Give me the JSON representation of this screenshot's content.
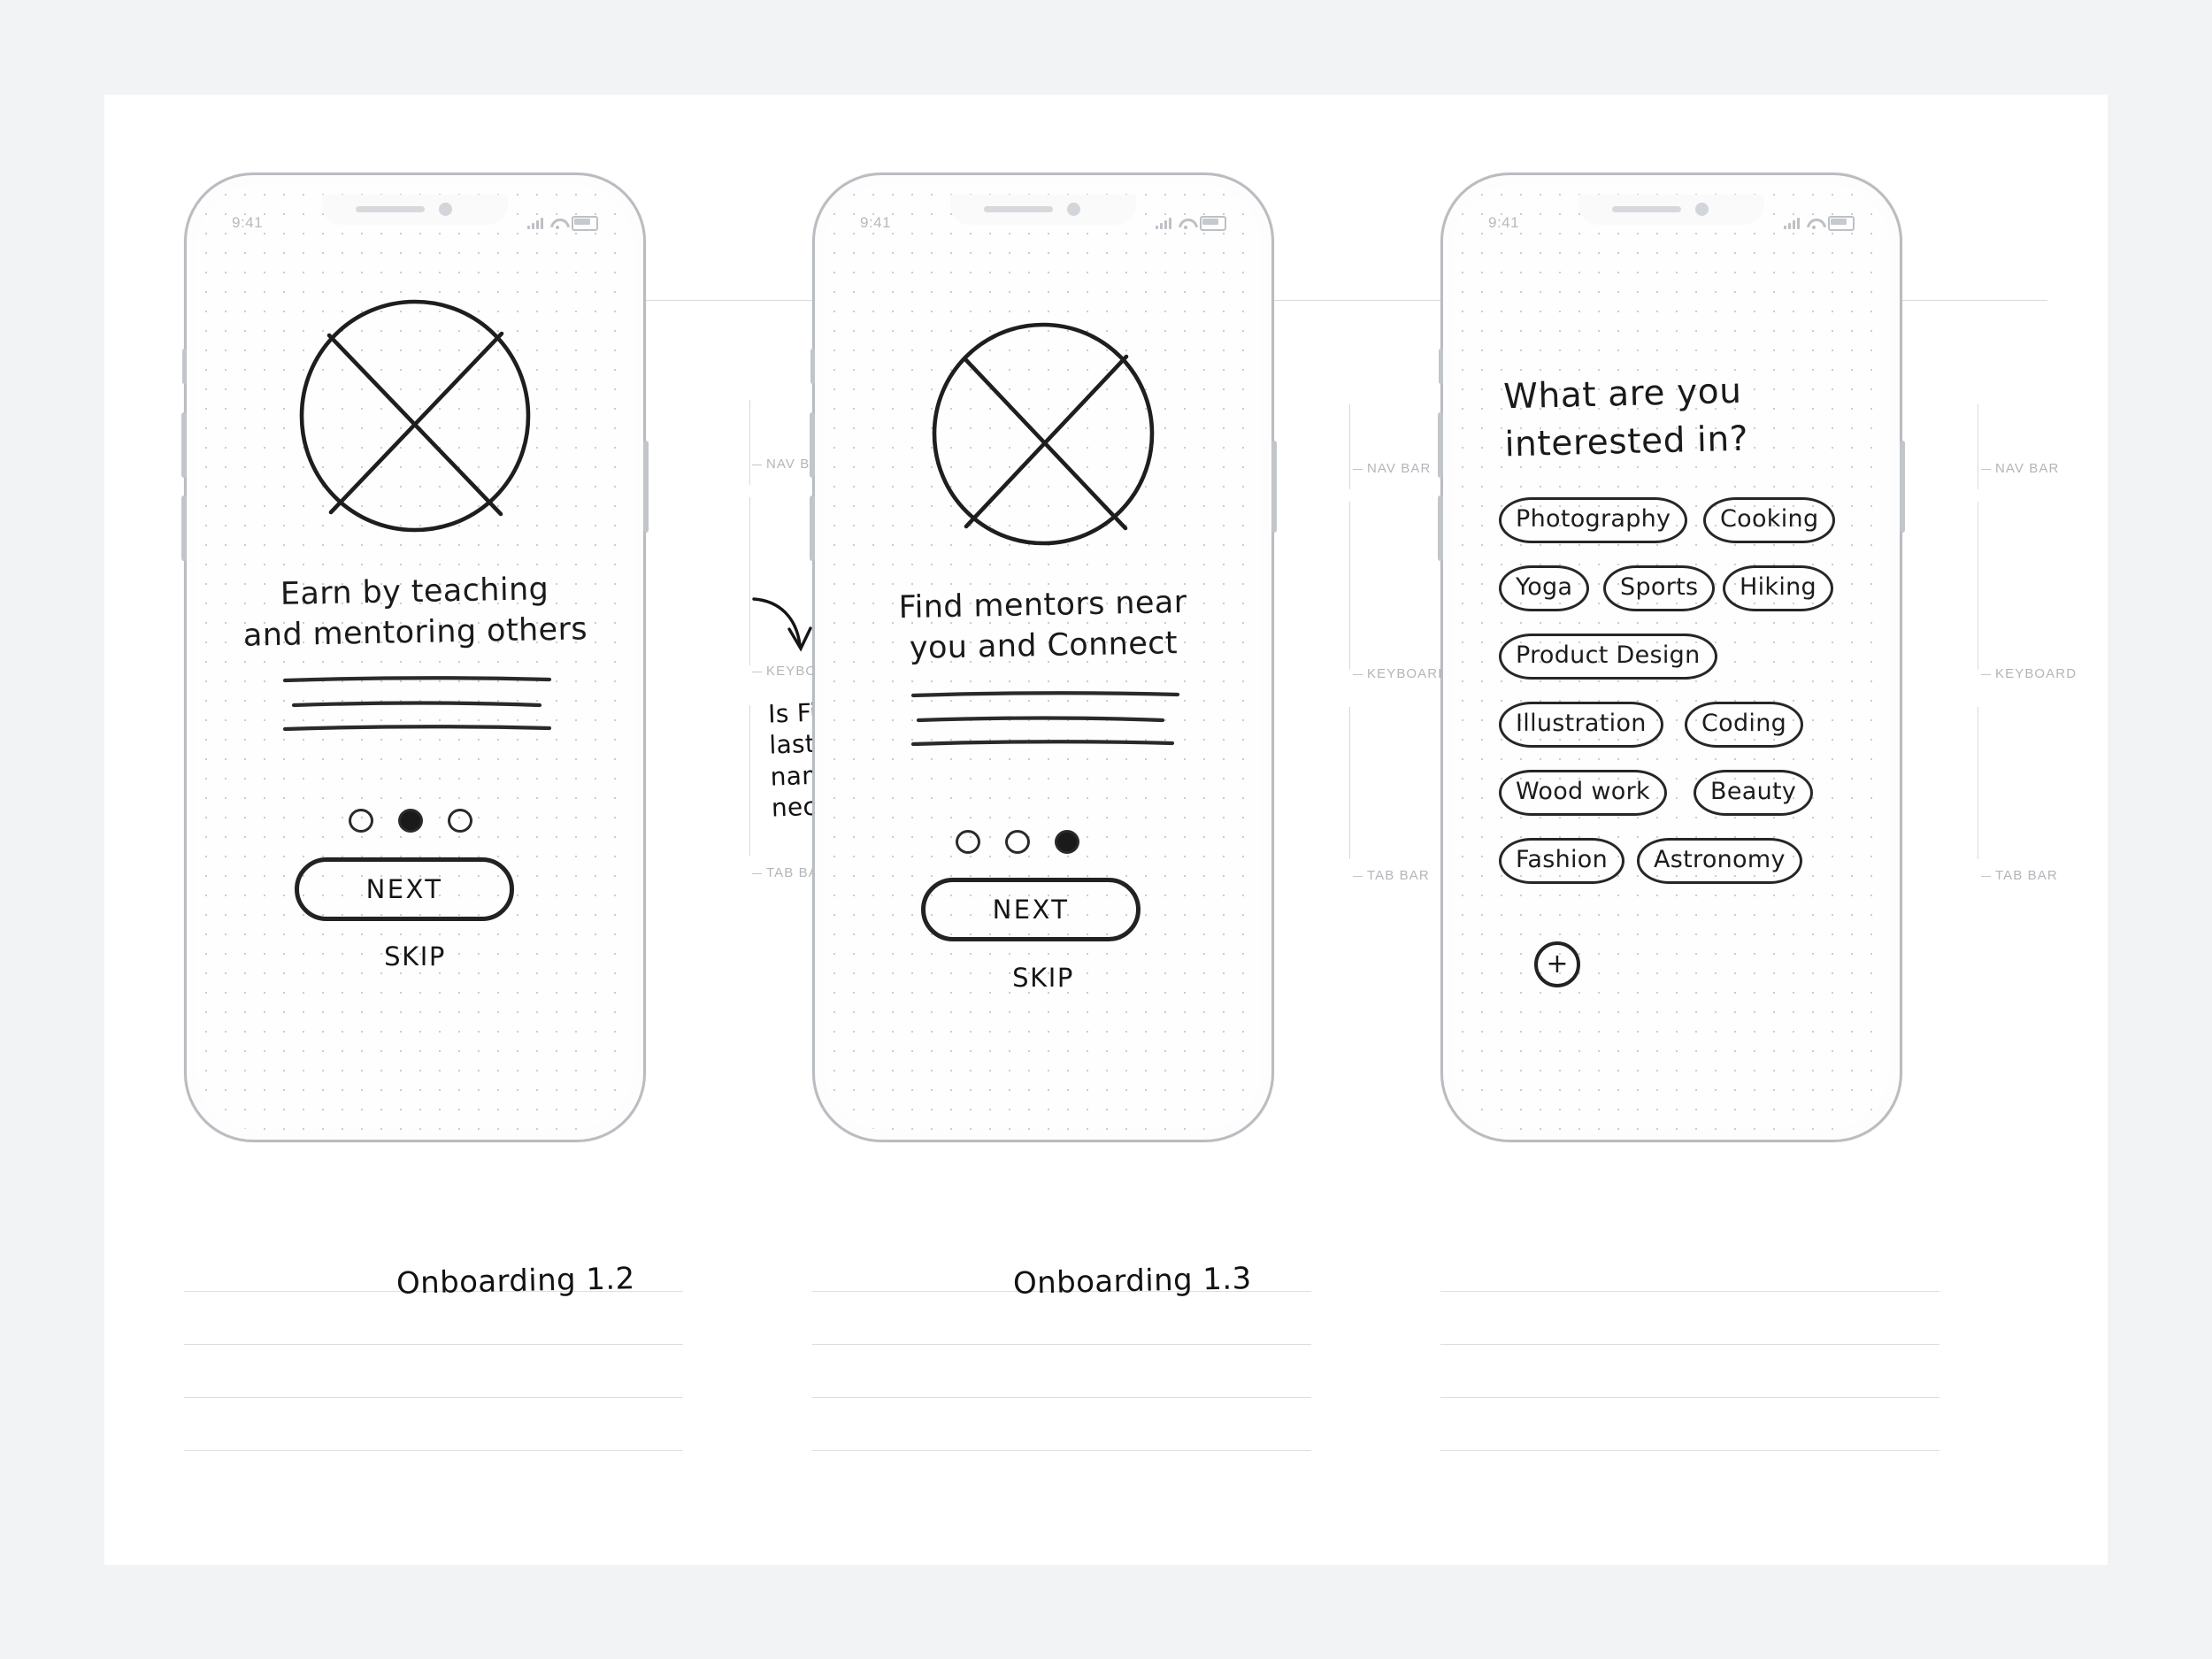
{
  "page": {
    "background_color": "#f1f3f4",
    "paper_color": "#ffffff"
  },
  "annotation_note": {
    "text": "Is First & last name necessary?"
  },
  "markers": {
    "nav_bar": "NAV BAR",
    "keyboard": "KEYBOARD",
    "tab_bar": "TAB BAR"
  },
  "status_bar": {
    "time": "9:41",
    "signal_icon": "signal-bars-icon",
    "wifi_icon": "wifi-icon",
    "battery_icon": "battery-icon"
  },
  "screens": [
    {
      "id": "onboarding-1-2",
      "caption": "Onboarding 1.2",
      "image_placeholder": "image-placeholder-circle-cross",
      "headline": "Earn by teaching\nand mentoring others",
      "body_lines": 3,
      "pagination": {
        "count": 3,
        "active_index": 1
      },
      "primary_button": "NEXT",
      "secondary_link": "SKIP"
    },
    {
      "id": "onboarding-1-3",
      "caption": "Onboarding 1.3",
      "image_placeholder": "image-placeholder-circle-cross",
      "headline": "Find mentors near\nyou and Connect",
      "body_lines": 3,
      "pagination": {
        "count": 3,
        "active_index": 2
      },
      "primary_button": "NEXT",
      "secondary_link": "SKIP"
    },
    {
      "id": "interests",
      "caption": "",
      "question": "What are you\ninterested in?",
      "add_button": "+",
      "interest_rows": [
        [
          "Photography",
          "Cooking"
        ],
        [
          "Yoga",
          "Sports",
          "Hiking"
        ],
        [
          "Product Design"
        ],
        [
          "Illustration",
          "Coding"
        ],
        [
          "Wood work",
          "Beauty"
        ],
        [
          "Fashion",
          "Astronomy"
        ]
      ]
    }
  ]
}
